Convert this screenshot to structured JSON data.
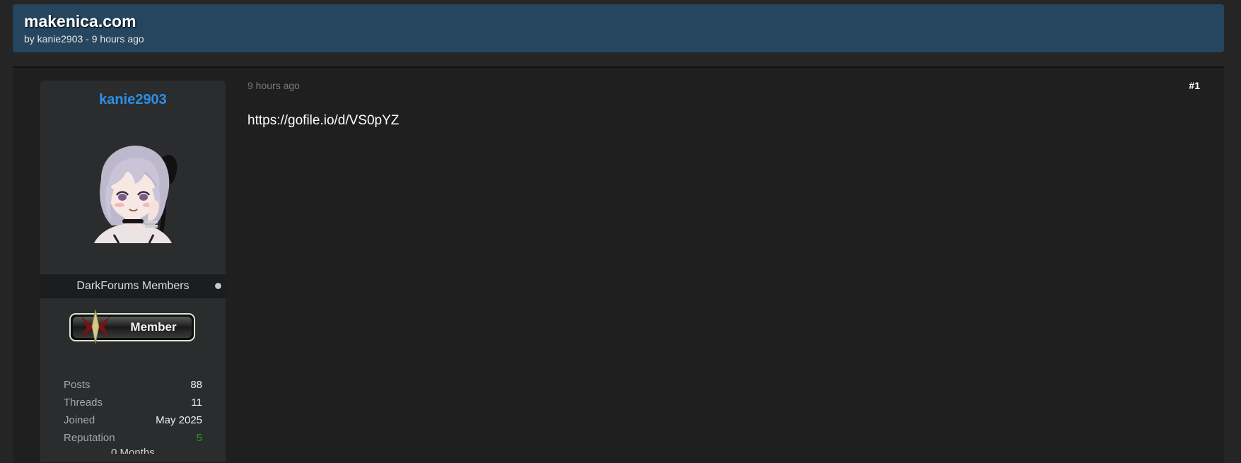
{
  "thread": {
    "title": "makenica.com",
    "byline": "by kanie2903 - 9 hours ago"
  },
  "post": {
    "time": "9 hours ago",
    "number": "#1",
    "body": "https://gofile.io/d/VS0pYZ"
  },
  "author": {
    "username": "kanie2903",
    "usergroup": "DarkForums Members",
    "rank_badge": "Member",
    "stats": [
      {
        "label": "Posts",
        "value": "88"
      },
      {
        "label": "Threads",
        "value": "11"
      },
      {
        "label": "Joined",
        "value": "May 2025"
      },
      {
        "label": "Reputation",
        "value": "5"
      }
    ],
    "next_stat_partial": "0 Months"
  },
  "colors": {
    "header_bg": "#26465f",
    "username": "#2d8fe8",
    "reputation": "#1e9e1e"
  }
}
